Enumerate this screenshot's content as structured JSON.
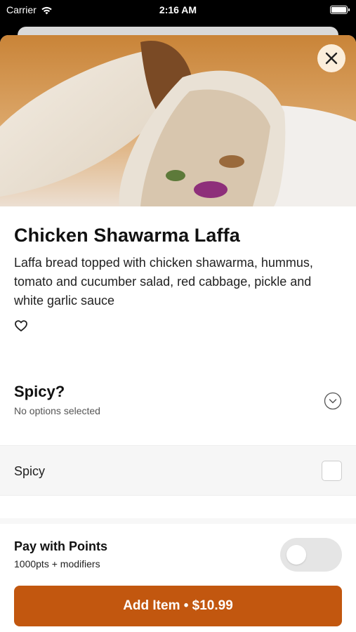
{
  "status_bar": {
    "carrier": "Carrier",
    "time": "2:16 AM"
  },
  "item": {
    "title": "Chicken Shawarma Laffa",
    "description": "Laffa bread topped with chicken shawarma, hummus, tomato and cucumber salad, red cabbage, pickle and white garlic sauce",
    "image": "chicken-shawarma-laffa-photo"
  },
  "modifier_group": {
    "title": "Spicy?",
    "subtitle": "No options selected",
    "options": [
      {
        "label": "Spicy",
        "checked": false
      }
    ]
  },
  "points": {
    "title": "Pay with Points",
    "subtitle": "1000pts + modifiers",
    "enabled": false
  },
  "add_button": {
    "label": "Add Item • $10.99"
  },
  "icons": {
    "close": "close-icon",
    "favorite": "heart-outline-icon",
    "expand": "chevron-down-circle-icon",
    "wifi": "wifi-icon",
    "battery": "battery-icon"
  },
  "colors": {
    "accent": "#c2570f",
    "toggle_off": "#e5e5e5"
  }
}
